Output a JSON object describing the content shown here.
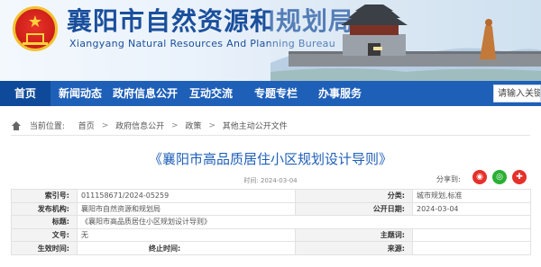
{
  "header": {
    "title_cn": "襄阳市自然资源和规划局",
    "title_en": "Xiangyang Natural Resources And Planning Bureau"
  },
  "nav": {
    "items": [
      {
        "label": "首页",
        "icon": "home-tab"
      },
      {
        "label": "新闻动态"
      },
      {
        "label": "政府信息公开"
      },
      {
        "label": "互动交流"
      },
      {
        "label": "专题专栏"
      },
      {
        "label": "办事服务"
      }
    ],
    "search_placeholder": "请输入关键"
  },
  "breadcrumb": {
    "current_label": "当前位置:",
    "items": [
      "首页",
      "政府信息公开",
      "政策",
      "其他主动公开文件"
    ],
    "separator": ">"
  },
  "article": {
    "title": "《襄阳市高品质居住小区规划设计导则》",
    "time_label": "时间:",
    "time": "2024-03-04",
    "share_label": "分享到:"
  },
  "info": {
    "index_label": "索引号:",
    "index": "011158671/2024-05259",
    "category_label": "分类:",
    "category": "城市规划,标准",
    "publisher_label": "发布机构:",
    "publisher": "襄阳市自然资源和规划局",
    "date_label": "公开日期:",
    "date": "2024-03-04",
    "name_label": "标题:",
    "name": "《襄阳市高品质居住小区规划设计导则》",
    "docno_label": "文号:",
    "docno": "无",
    "subject_label": "主题词:",
    "subject": "",
    "effective_label": "生效时间:",
    "effective": "",
    "expiry_label": "终止时间:",
    "expiry": "",
    "source_label": "来源:",
    "source": ""
  },
  "colors": {
    "nav_blue": "#1e5fb8",
    "nav_active": "#0f4a9a",
    "title_blue": "#1a4f9c",
    "weibo_red": "#e6302a",
    "wechat_green": "#2ab034"
  }
}
